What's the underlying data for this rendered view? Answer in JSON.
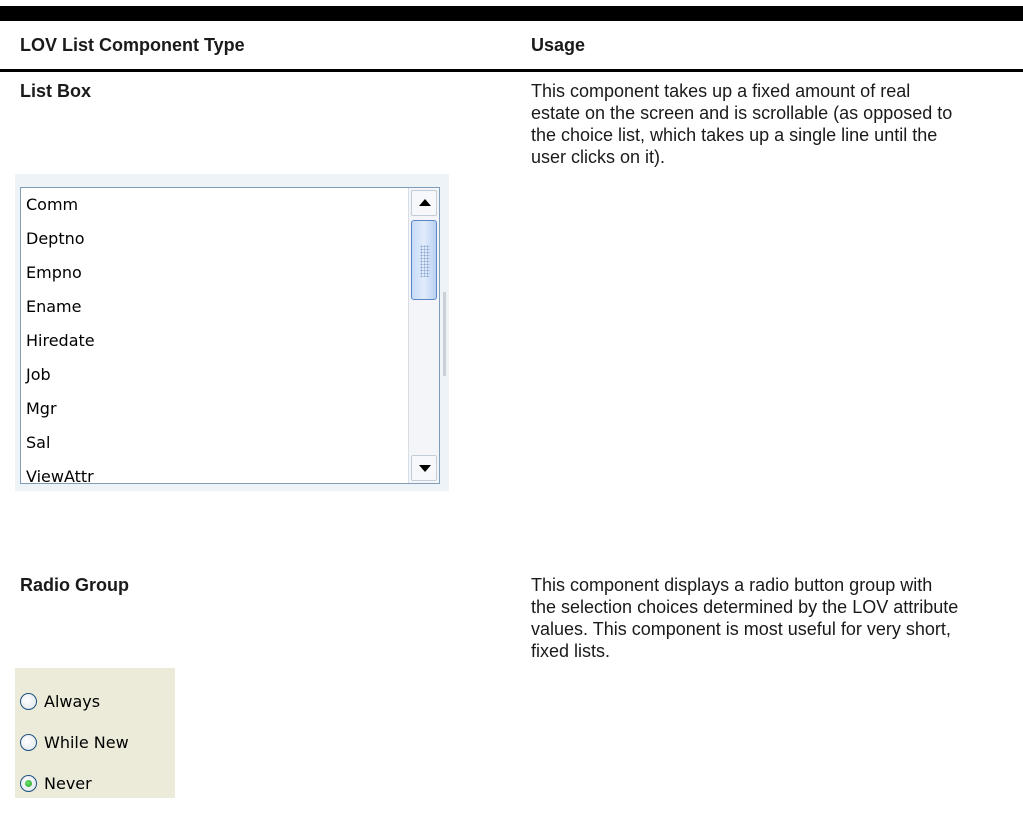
{
  "table": {
    "header": {
      "col1": "LOV List Component Type",
      "col2": "Usage"
    },
    "rows": [
      {
        "type": "List Box",
        "usage": "This component takes up a fixed amount of real estate on the screen and is scrollable (as opposed to the choice list, which takes up a single line until the user clicks on it)."
      },
      {
        "type": "Radio Group",
        "usage": "This component displays a radio button group with the selection choices determined by the LOV attribute values. This component is most useful for very short, fixed lists."
      }
    ]
  },
  "listbox": {
    "items": [
      "Comm",
      "Deptno",
      "Empno",
      "Ename",
      "Hiredate",
      "Job",
      "Mgr",
      "Sal",
      "ViewAttr"
    ]
  },
  "radio_group": {
    "options": [
      {
        "label": "Always",
        "selected": false
      },
      {
        "label": "While New",
        "selected": false
      },
      {
        "label": "Never",
        "selected": true
      }
    ]
  },
  "colors": {
    "rule": "#000000",
    "listbox_border": "#7f9db9",
    "listbox_frame": "#eef3f7",
    "radio_frame": "#ecead8",
    "radio_selected_dot": "#1d9e1d"
  },
  "icons": [
    "scroll-up-arrow-icon",
    "scroll-down-arrow-icon",
    "scrollbar-grip-icon",
    "radio-button-icon"
  ]
}
